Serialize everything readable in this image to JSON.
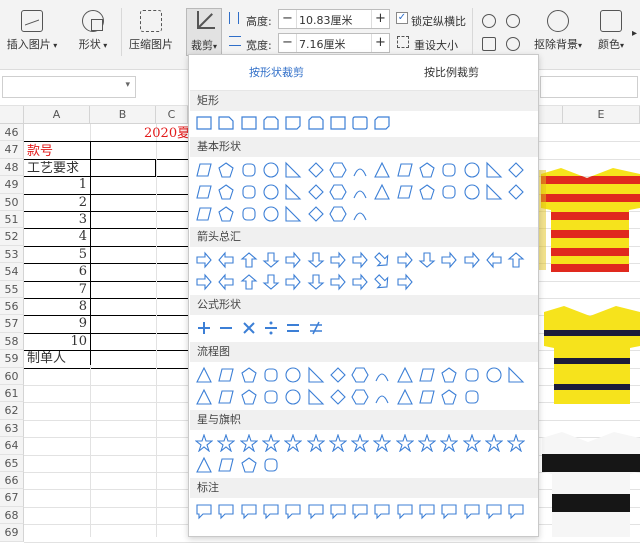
{
  "ribbon": {
    "insert_image": "插入图片",
    "shape": "形状",
    "compress_image": "压缩图片",
    "crop": "裁剪",
    "height_label": "高度:",
    "height_value": "10.83厘米",
    "width_label": "宽度:",
    "width_value": "7.16厘米",
    "lock_ratio": "锁定纵横比",
    "reset_size": "重设大小",
    "remove_bg": "抠除背景",
    "color": "颜色"
  },
  "columns": [
    "A",
    "B",
    "C"
  ],
  "right_col_letter": "E",
  "rows": [
    "46",
    "47",
    "48",
    "49",
    "50",
    "51",
    "52",
    "53",
    "54",
    "55",
    "56",
    "57",
    "58",
    "59",
    "60",
    "61",
    "62",
    "63",
    "64",
    "65",
    "66",
    "67",
    "68",
    "69"
  ],
  "sheet": {
    "title_fragment": "2020夏",
    "style_no_label": "款号",
    "process_req_label": "工艺要求",
    "maker_label": "制单人",
    "numbers": [
      "1",
      "2",
      "3",
      "4",
      "5",
      "6",
      "7",
      "8",
      "9",
      "10"
    ]
  },
  "crop_panel": {
    "tab_shape": "按形状裁剪",
    "tab_ratio": "按比例裁剪",
    "sections": {
      "rect": "矩形",
      "basic": "基本形状",
      "arrows": "箭头总汇",
      "formula": "公式形状",
      "flowchart": "流程图",
      "stars": "星与旗帜",
      "callouts": "标注"
    }
  },
  "colors": {
    "accent_blue": "#2f6ec8",
    "shape_outline": "#3c7fd6",
    "title_red": "#e21b1b",
    "shirt_yellow": "#f6e31c",
    "shirt_red": "#e0291e"
  }
}
